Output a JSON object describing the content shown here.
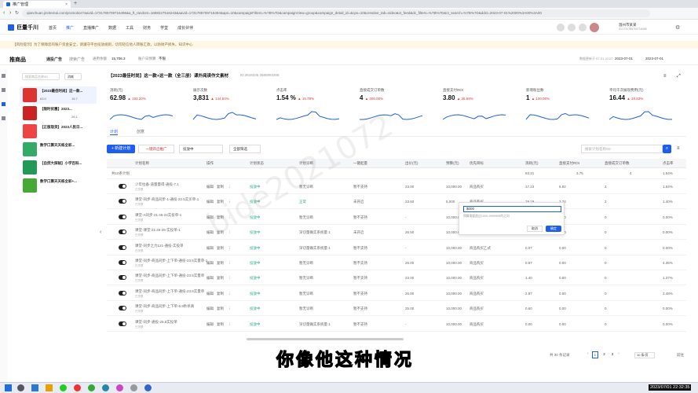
{
  "browser": {
    "tab_title": "推广管理",
    "url": "qianchuan.jinritemai.com/promotion?aavid=1731785709716496&a_ft_random=1688227516243&aavid=1731785709716494&aps=10&campaignFilters=%7B%7D&campaignView=group&campaign_detail_id=&cps=10&creative_tab=video&ct_feed&dc_filters=%7B%7D&ct_search=%7B%7D&ddct=2023-07-01%2000%3A00%3A00"
  },
  "app": {
    "logo": "巨量千川",
    "nav": [
      "首页",
      "推广",
      "直播推广",
      "数据",
      "工具",
      "财务",
      "学堂",
      "成长伙伴"
    ],
    "user": "温州市某某",
    "user_sub": "ID:1731785709716496"
  },
  "notice": "【风险提示】为了保障您的账户资金安全，请遵守平台投放规则，切勿轻信他人转账汇款，以防财产损失。知识中心",
  "subbar": {
    "mode": "推商品",
    "mode_items": [
      "通投广告",
      "搜索广告"
    ],
    "balance_label": "通用余额",
    "balance": "15,706.3",
    "budget_label": "账户日预算",
    "budget": "不限",
    "date_label": "数据更新于 07-01 22:27",
    "date_from": "2023-07-01",
    "date_to": "2023-07-01"
  },
  "list": {
    "search": "搜索商品名称/ID",
    "filter": "消耗",
    "items": [
      {
        "title": "【2023最佳时尚】这一款...",
        "roi": "63.0",
        "cost": "15.7"
      },
      {
        "title": "【限时优惠】2023...",
        "roi": "",
        "cost": "26.1"
      },
      {
        "title": "【正版现货】2023人民日...",
        "roi": "",
        "cost": ""
      },
      {
        "title": "数学口算天天练全彩...",
        "roi": "",
        "cost": ""
      },
      {
        "title": "【自然大探秘】小学百科...",
        "roi": "",
        "cost": ""
      },
      {
        "title": "数学口算天天练全彩+...",
        "roi": "",
        "cost": ""
      }
    ]
  },
  "product": {
    "title": "【2023最佳时尚】这一款+这一款（全三册）课外阅读作文素材",
    "id": "ID:3618335 3585993308"
  },
  "metrics": [
    {
      "label": "消耗(元)",
      "value": "62.98",
      "delta": "▲ 193.20%"
    },
    {
      "label": "展示次数",
      "value": "3,831",
      "delta": "▲ 144.64%"
    },
    {
      "label": "点击率",
      "value": "1.54 %",
      "delta": "▲ 15.79%"
    },
    {
      "label": "直接成交订单数",
      "value": "4",
      "delta": "▲ 300.00%"
    },
    {
      "label": "直接支付ROI",
      "value": "3.80",
      "delta": "▲ 36.69%"
    },
    {
      "label": "新增粉丝数",
      "value": "1",
      "delta": "▲ 100.00%"
    },
    {
      "label": "平均千次展现费用(元)",
      "value": "16.44",
      "delta": "▲ 19.83%"
    }
  ],
  "tabs": [
    "计划",
    "创意"
  ],
  "toolbar": {
    "new_plan": "+ 新建计划",
    "batch": "一键开启推广",
    "status": "投放中",
    "filter": "全部筛选",
    "search": "搜索计划名称/ID"
  },
  "columns": [
    "计划名称",
    "操作",
    "计划状态",
    "计划诊断",
    "一键起量",
    "出价(元)",
    "预算(元)",
    "优先目标",
    "消耗(元)",
    "直接支付ROI",
    "直接成交订单数",
    "点击率"
  ],
  "summary": {
    "label": "共10条计划",
    "cost": "63.21",
    "roi": "3.75",
    "orders": "4",
    "ctr": "1.54%"
  },
  "rows": [
    {
      "name": "少年拉备-道量量得-通投-7.1",
      "status": "投放中",
      "diag": "暂无诊断",
      "boost": "暂不支持",
      "bid": "23.00",
      "budget": "10,000.00",
      "goal": "商品购买",
      "cost": "17.23",
      "roi": "6.92",
      "orders": "2",
      "ctr": "1.64%"
    },
    {
      "name": "课堂-同步-商品同步-1-通投-22.5实买单-1",
      "status": "投放中",
      "diag": "正常",
      "boost": "未开启",
      "bid": "23.60",
      "budget": "5,000",
      "goal": "商品购买",
      "cost": "19.19",
      "roi": "3.74",
      "orders": "2",
      "ctr": "1.40%"
    },
    {
      "name": "课堂-A同步-21:46-24实投单-1",
      "status": "投放中",
      "diag": "暂无诊断",
      "boost": "暂不支持",
      "bid": "-",
      "budget": "10,000.00",
      "goal": "商品购买",
      "cost": "0.00",
      "roi": "0.00",
      "orders": "0",
      "ctr": "0.00%"
    },
    {
      "name": "课堂-课堂-21:46-25-实投单-1",
      "status": "投放中",
      "diag": "深切量确实系统量 1",
      "boost": "未开启",
      "bid": "26.50",
      "budget": "10,000.00",
      "goal": "商品购买",
      "cost": "0.00",
      "roi": "0.00",
      "orders": "0",
      "ctr": "0.00%"
    },
    {
      "name": "课堂-同步之力121-通投-实投单",
      "status": "投放中",
      "diag": "深切量确实系统量 1",
      "boost": "暂不支持",
      "bid": "-",
      "budget": "10,000.00",
      "goal": "商品购买乙式",
      "cost": "0.07",
      "roi": "0.00",
      "orders": "0",
      "ctr": "0.00%"
    },
    {
      "name": "课堂-同步-商品同步-上下单-通投-23.5实量单-1",
      "status": "投放中",
      "diag": "暂无诊断",
      "boost": "暂不支持",
      "bid": "26.00",
      "budget": "10,000.00",
      "goal": "商品购买",
      "cost": "0.67",
      "roi": "0.00",
      "orders": "0",
      "ctr": "4.35%"
    },
    {
      "name": "课堂-同步-商品同步-上下单-通投-23.5实量单",
      "status": "投放中",
      "diag": "暂无诊断",
      "boost": "暂不支持",
      "bid": "23.00",
      "budget": "10,000.00",
      "goal": "商品购买",
      "cost": "1.40",
      "roi": "0.00",
      "orders": "0",
      "ctr": "1.37%"
    },
    {
      "name": "课堂-同步-商品同步-上下单-通投-23.6实量单",
      "status": "投放中",
      "diag": "暂无诊断",
      "boost": "暂不支持",
      "bid": "26.00",
      "budget": "10,000.00",
      "goal": "商品购买",
      "cost": "2.87",
      "roi": "0.00",
      "orders": "0",
      "ctr": "2.48%"
    },
    {
      "name": "课堂-同步-商品同步-上下单-9.9秒杀真",
      "status": "投放中",
      "diag": "暂无诊断",
      "boost": "暂不支持",
      "bid": "25.00",
      "budget": "10,000.00",
      "goal": "商品购买",
      "cost": "0.60",
      "roi": "0.00",
      "orders": "0",
      "ctr": "0.00%"
    },
    {
      "name": "课堂-同步-通投-25.5实投单",
      "status": "投放中",
      "diag": "深切量确实系统量 1",
      "boost": "暂不支持",
      "bid": "-",
      "budget": "10,000.00",
      "goal": "商品购买",
      "cost": "0.00",
      "roi": "0.00",
      "orders": "0",
      "ctr": "0.00%"
    }
  ],
  "popup": {
    "value": "$000",
    "hint": "预算需要超过1000-9999999的之间",
    "cancel": "取消",
    "ok": "确定"
  },
  "pagination": {
    "total": "共 30 条记录",
    "pages": [
      "1",
      "2",
      "3"
    ],
    "size": "10 条/页",
    "goto": "前往"
  },
  "subtitle": "你像他这种情况",
  "watermark": "bide2021072",
  "clock": "2023/07/01 22:32:35"
}
